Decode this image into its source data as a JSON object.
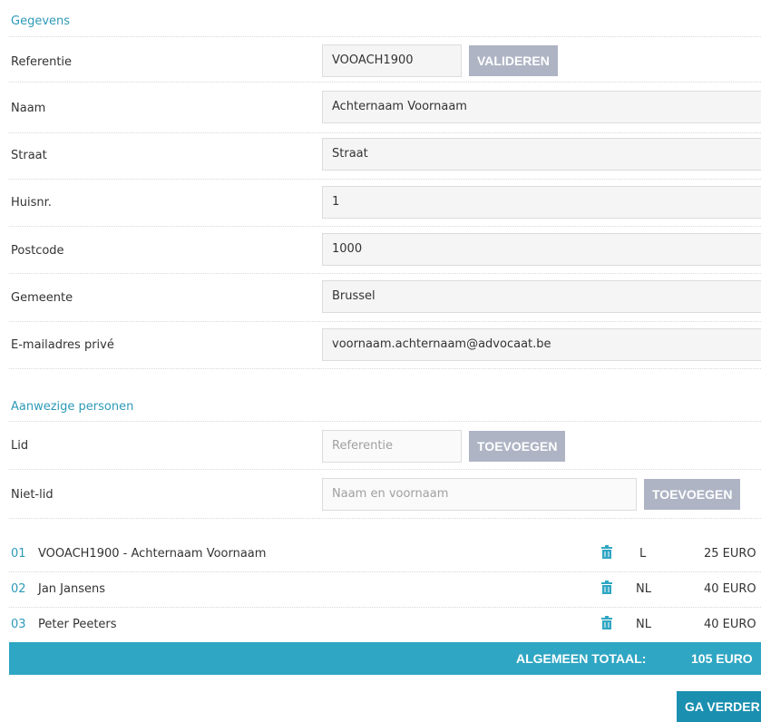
{
  "gegevens": {
    "title": "Gegevens",
    "referentie": {
      "label": "Referentie",
      "value": "VOOACH1900",
      "button": "VALIDEREN"
    },
    "naam": {
      "label": "Naam",
      "value": "Achternaam Voornaam"
    },
    "straat": {
      "label": "Straat",
      "value": "Straat"
    },
    "huisnr": {
      "label": "Huisnr.",
      "value": "1"
    },
    "postcode": {
      "label": "Postcode",
      "value": "1000"
    },
    "gemeente": {
      "label": "Gemeente",
      "value": "Brussel"
    },
    "email": {
      "label": "E-mailadres privé",
      "value": "voornaam.achternaam@advocaat.be"
    }
  },
  "aanwezig": {
    "title": "Aanwezige personen",
    "lid": {
      "label": "Lid",
      "placeholder": "Referentie",
      "button": "TOEVOEGEN"
    },
    "nietlid": {
      "label": "Niet-lid",
      "placeholder": "Naam en voornaam",
      "button": "TOEVOEGEN"
    }
  },
  "persons": [
    {
      "num": "01",
      "name": "VOOACH1900 - Achternaam Voornaam",
      "lang": "L",
      "amount": "25 EURO"
    },
    {
      "num": "02",
      "name": "Jan Jansens",
      "lang": "NL",
      "amount": "40 EURO"
    },
    {
      "num": "03",
      "name": "Peter Peeters",
      "lang": "NL",
      "amount": "40 EURO"
    }
  ],
  "total": {
    "label": "ALGEMEEN TOTAAL:",
    "value": "105 EURO"
  },
  "go_button": "GA VERDER",
  "colors": {
    "accent": "#2fa6c3",
    "button_gray": "#aeb4c4",
    "title_blue": "#2e9ab8"
  }
}
